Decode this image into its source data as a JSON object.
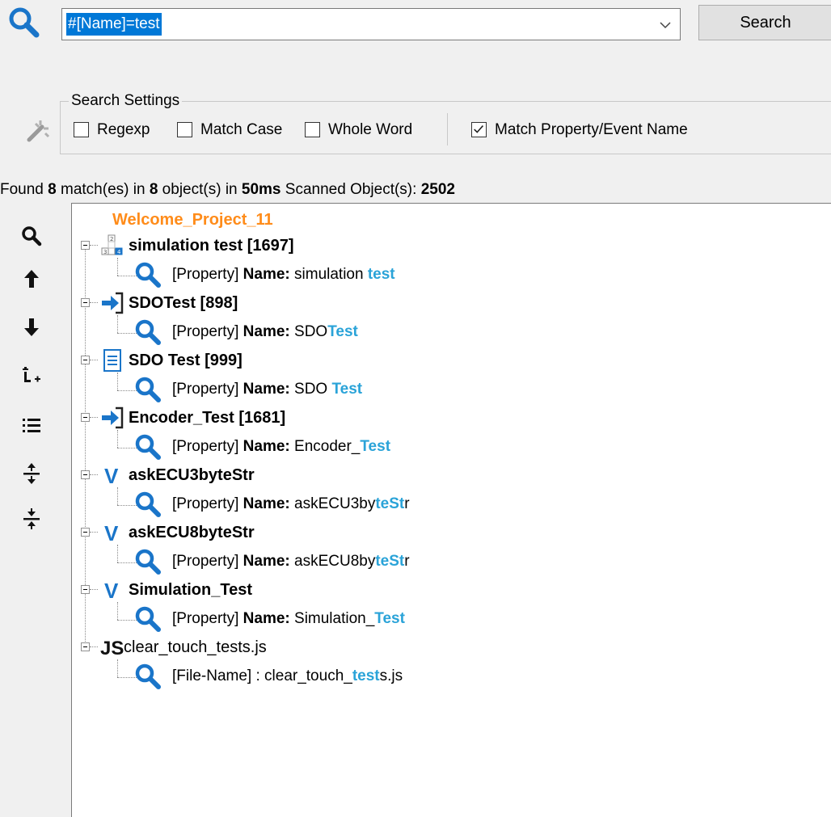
{
  "search": {
    "query": "#[Name]=test",
    "button_label": "Search"
  },
  "settings": {
    "legend": "Search Settings",
    "regexp": {
      "label": "Regexp",
      "checked": false
    },
    "match_case": {
      "label": "Match Case",
      "checked": false
    },
    "whole_word": {
      "label": "Whole Word",
      "checked": false
    },
    "match_property": {
      "label": "Match Property/Event Name",
      "checked": true
    }
  },
  "status": {
    "prefix": "Found ",
    "matches": "8",
    "matches_suffix": " match(es) in ",
    "objects": "8",
    "objects_suffix": " object(s) in ",
    "time": "50ms",
    "scanned_label": " Scanned Object(s): ",
    "scanned": "2502"
  },
  "sidebar": {
    "icons": [
      "search-icon",
      "arrow-up-icon",
      "arrow-down-icon",
      "expand-add-icon",
      "list-icon",
      "expand-all-icon",
      "collapse-all-icon"
    ]
  },
  "tree": {
    "root": "Welcome_Project_11",
    "items": [
      {
        "icon": "grid-icon",
        "label": "simulation test [1697]",
        "bold": true,
        "match": {
          "kind": "[Property] ",
          "field": "Name:",
          "sep": " ",
          "pre": "simulation ",
          "hl": "test",
          "post": ""
        }
      },
      {
        "icon": "arrow-right-icon",
        "label": "SDOTest [898]",
        "bold": true,
        "match": {
          "kind": "[Property] ",
          "field": "Name:",
          "sep": " ",
          "pre": "SDO",
          "hl": "Test",
          "post": ""
        }
      },
      {
        "icon": "document-icon",
        "label": "SDO Test [999]",
        "bold": true,
        "match": {
          "kind": "[Property] ",
          "field": "Name:",
          "sep": " ",
          "pre": "SDO ",
          "hl": "Test",
          "post": ""
        }
      },
      {
        "icon": "arrow-right-icon",
        "label": "Encoder_Test [1681]",
        "bold": true,
        "match": {
          "kind": "[Property] ",
          "field": "Name:",
          "sep": " ",
          "pre": "Encoder_",
          "hl": "Test",
          "post": ""
        }
      },
      {
        "icon": "variable-icon",
        "label": "askECU3byteStr",
        "bold": true,
        "match": {
          "kind": "[Property] ",
          "field": "Name:",
          "sep": " ",
          "pre": "askECU3by",
          "hl": "teSt",
          "post": "r"
        }
      },
      {
        "icon": "variable-icon",
        "label": "askECU8byteStr",
        "bold": true,
        "match": {
          "kind": "[Property] ",
          "field": "Name:",
          "sep": " ",
          "pre": "askECU8by",
          "hl": "teSt",
          "post": "r"
        }
      },
      {
        "icon": "variable-icon",
        "label": "Simulation_Test",
        "bold": true,
        "match": {
          "kind": "[Property] ",
          "field": "Name:",
          "sep": " ",
          "pre": "Simulation_",
          "hl": "Test",
          "post": ""
        }
      },
      {
        "icon": "javascript-file-icon",
        "label": "clear_touch_tests.js",
        "bold": false,
        "match": {
          "kind": "[File-Name] : ",
          "field": "",
          "sep": "",
          "pre": "clear_touch_",
          "hl": "test",
          "post": "s.js"
        }
      }
    ]
  },
  "colors": {
    "root": "#ff8c1a",
    "highlight": "#2aa3d8",
    "icon_blue": "#1a75c9",
    "selection": "#0078d7"
  }
}
